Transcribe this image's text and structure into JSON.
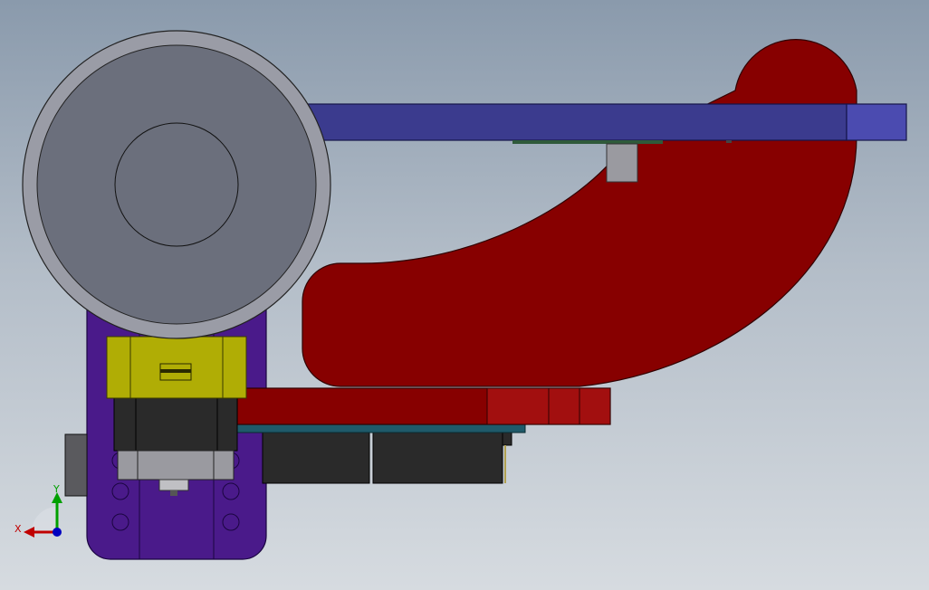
{
  "viewport": {
    "background_top": "#8a9aac",
    "background_bottom": "#d6dbe0"
  },
  "colors": {
    "red_part": "#870000",
    "red_highlight": "#a20f0f",
    "blue_bar": "#3b3b8e",
    "blue_bar_end": "#4b4bb0",
    "purple_plate": "#4a1a8a",
    "yellow_block": "#b0ad05",
    "wheel": "#6b6f7c",
    "wheel_rim": "#9a9ca6",
    "dark_block": "#2a2a2a",
    "grey_block": "#9a9aa0",
    "teal_board": "#1f5a6a",
    "axis_x": "#c00000",
    "axis_y": "#00a000",
    "axis_z": "#0000c0"
  },
  "triad": {
    "x_label": "X",
    "y_label": "Y",
    "x_icon": "axis-x-arrow-icon",
    "y_icon": "axis-y-arrow-icon",
    "z_icon": "axis-z-dot-icon"
  }
}
